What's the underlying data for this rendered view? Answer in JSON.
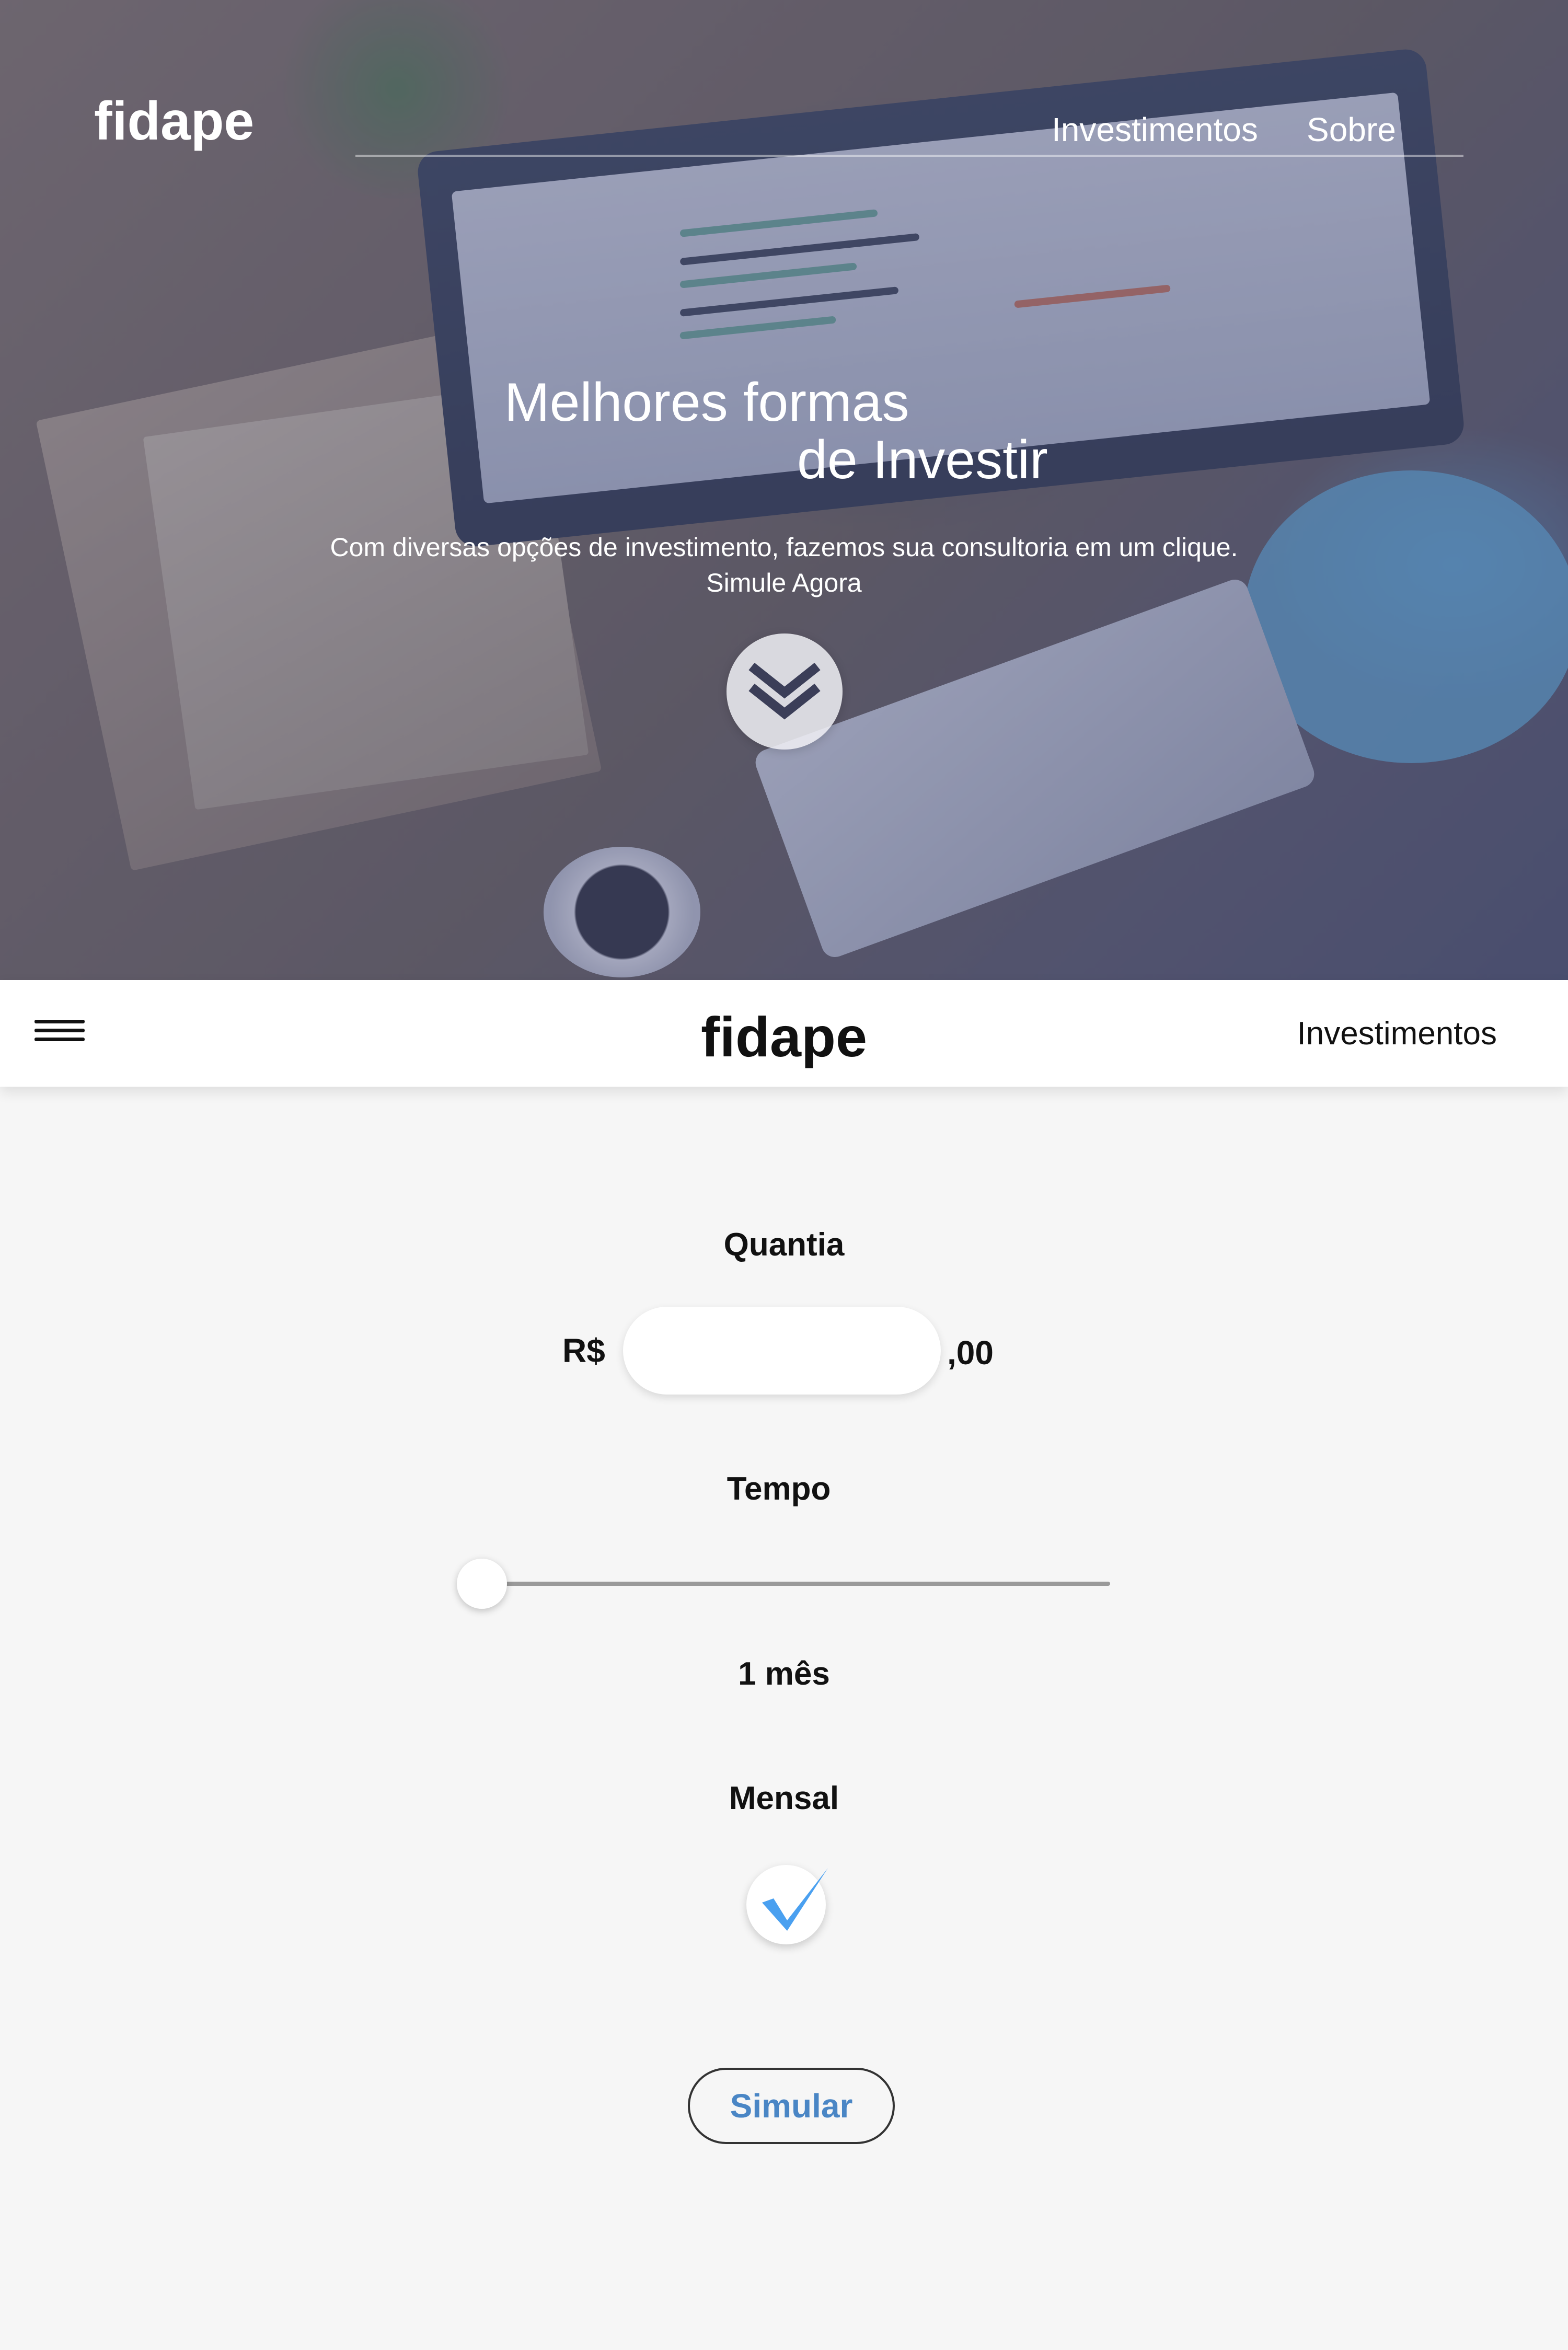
{
  "hero": {
    "logo": "fidape",
    "nav": [
      "Investimentos",
      "Sobre"
    ],
    "title_line1": "Melhores formas",
    "title_line2": "de Investir",
    "subtitle": "Com diversas opções de investimento, fazemos sua consultoria em um clique.",
    "cta": "Simule Agora",
    "scroll_icon": "chevron-double-down-icon"
  },
  "appbar": {
    "menu_icon": "hamburger-menu-icon",
    "logo": "fidape",
    "link": "Investimentos"
  },
  "form": {
    "amount": {
      "label": "Quantia",
      "prefix": "R$",
      "suffix": ",00",
      "value": ""
    },
    "time": {
      "label": "Tempo",
      "slider_value_fraction": 0,
      "display": "1 mês"
    },
    "monthly": {
      "label": "Mensal",
      "checked": true,
      "check_color": "#4aa0f0"
    },
    "submit_label": "Simular"
  },
  "colors": {
    "accent": "#4a86c5",
    "background": "#f6f6f6"
  }
}
